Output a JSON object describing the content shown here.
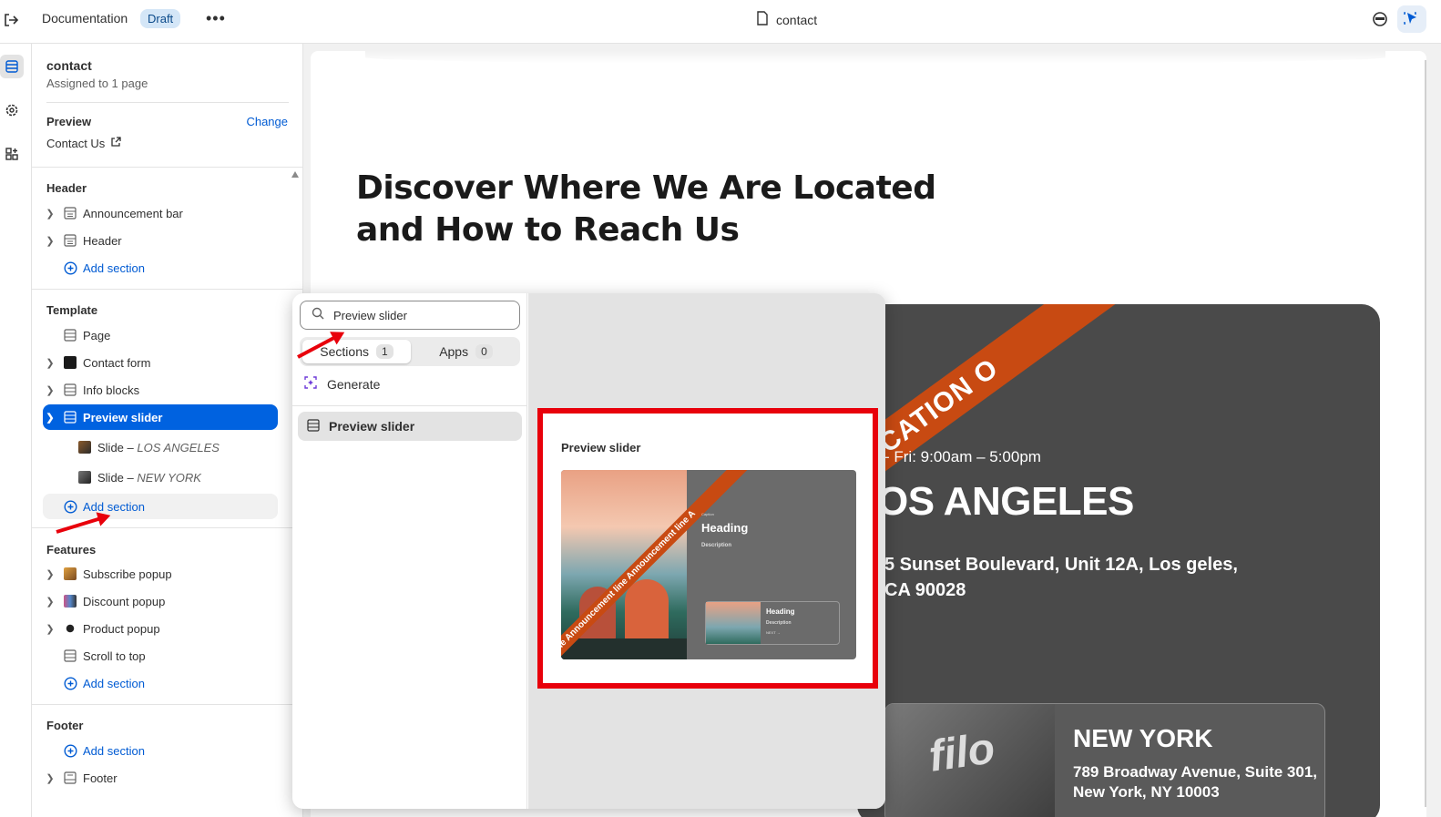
{
  "topbar": {
    "theme_name": "Documentation",
    "status_badge": "Draft",
    "more_label": "•••",
    "page_name": "contact"
  },
  "sidebar": {
    "template_name": "contact",
    "assigned": "Assigned to 1 page",
    "preview_label": "Preview",
    "change_label": "Change",
    "preview_page": "Contact Us",
    "header_group": {
      "title": "Header",
      "items": [
        "Announcement bar",
        "Header"
      ],
      "add": "Add section"
    },
    "template_group": {
      "title": "Template",
      "items": [
        "Page",
        "Contact form",
        "Info blocks",
        "Preview slider"
      ],
      "blocks": [
        {
          "prefix": "Slide – ",
          "name": "LOS ANGELES"
        },
        {
          "prefix": "Slide – ",
          "name": "NEW YORK"
        }
      ],
      "add": "Add section"
    },
    "features_group": {
      "title": "Features",
      "items": [
        "Subscribe popup",
        "Discount popup",
        "Product popup",
        "Scroll to top"
      ],
      "add": "Add section"
    },
    "footer_group": {
      "title": "Footer",
      "add": "Add section",
      "items": [
        "Footer"
      ]
    }
  },
  "picker": {
    "search_value": "Preview slider",
    "tabs": [
      {
        "label": "Sections",
        "count": "1"
      },
      {
        "label": "Apps",
        "count": "0"
      }
    ],
    "generate_label": "Generate",
    "result_label": "Preview slider",
    "preview": {
      "title": "Preview slider",
      "ribbon_text": "t line  Announcement line  Announcement line  A",
      "caption": "Caption",
      "heading": "Heading",
      "description": "Description",
      "card_heading": "Heading",
      "card_description": "Description",
      "card_next": "NEXT →"
    }
  },
  "page": {
    "headline": "Discover Where We Are Located and How to Reach Us",
    "ribbon": "OCATION  O",
    "hours": "- Fri: 9:00am – 5:00pm",
    "city": "OS ANGELES",
    "address": "5 Sunset Boulevard, Unit 12A, Los geles, CA 90028",
    "ny_logo": "filo",
    "ny_title": "NEW YORK",
    "ny_address": "789 Broadway Avenue, Suite 301, New York, NY 10003"
  },
  "colors": {
    "accent": "#0062e0",
    "annotation": "#e8000b",
    "ribbon": "#c84a12",
    "card": "#4a4a4a"
  }
}
